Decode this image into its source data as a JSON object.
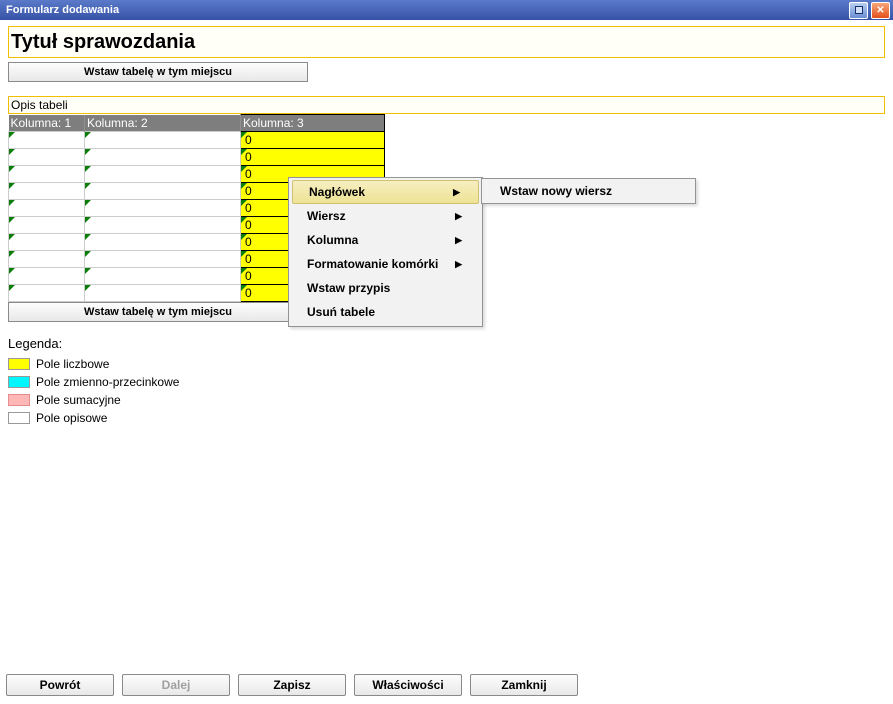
{
  "window": {
    "title": "Formularz dodawania"
  },
  "report_title": "Tytuł sprawozdania",
  "insert_table_btn": "Wstaw tabelę w tym miejscu",
  "table_description": "Opis tabeli",
  "columns": {
    "c1": "Kolumna: 1",
    "c2": "Kolumna: 2",
    "c3": "Kolumna: 3"
  },
  "rows": [
    {
      "c1": "",
      "c2": "",
      "c3": "0"
    },
    {
      "c1": "",
      "c2": "",
      "c3": "0"
    },
    {
      "c1": "",
      "c2": "",
      "c3": "0"
    },
    {
      "c1": "",
      "c2": "",
      "c3": "0"
    },
    {
      "c1": "",
      "c2": "",
      "c3": "0"
    },
    {
      "c1": "",
      "c2": "",
      "c3": "0"
    },
    {
      "c1": "",
      "c2": "",
      "c3": "0"
    },
    {
      "c1": "",
      "c2": "",
      "c3": "0"
    },
    {
      "c1": "",
      "c2": "",
      "c3": "0"
    },
    {
      "c1": "",
      "c2": "",
      "c3": "0"
    }
  ],
  "context_menu": {
    "items": [
      {
        "label": "Nagłówek",
        "submenu": true,
        "highlighted": true
      },
      {
        "label": "Wiersz",
        "submenu": true
      },
      {
        "label": "Kolumna",
        "submenu": true
      },
      {
        "label": "Formatowanie komórki",
        "submenu": true
      },
      {
        "label": "Wstaw przypis"
      },
      {
        "label": "Usuń tabele"
      }
    ],
    "submenu": {
      "insert_row": "Wstaw nowy wiersz"
    }
  },
  "legend": {
    "title": "Legenda:",
    "items": [
      {
        "label": "Pole liczbowe",
        "color": "yellow"
      },
      {
        "label": "Pole zmienno-przecinkowe",
        "color": "cyan"
      },
      {
        "label": "Pole sumacyjne",
        "color": "pink"
      },
      {
        "label": "Pole opisowe",
        "color": "white"
      }
    ]
  },
  "bottom": {
    "back": "Powrót",
    "next": "Dalej",
    "save": "Zapisz",
    "props": "Właściwości",
    "close": "Zamknij"
  }
}
